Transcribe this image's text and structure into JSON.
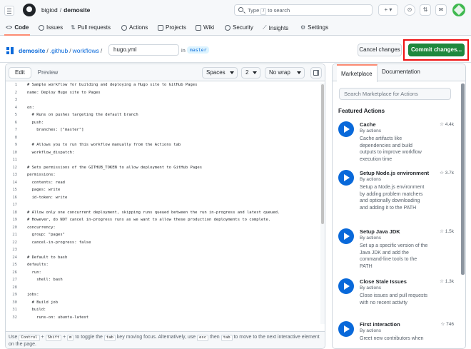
{
  "nav": {
    "owner": "bigiod",
    "repo": "demosite",
    "search_prefix": "Type",
    "search_key": "/",
    "search_suffix": "to search",
    "plus_label": "+ ▾",
    "tabs": [
      "Code",
      "Issues",
      "Pull requests",
      "Actions",
      "Projects",
      "Wiki",
      "Security",
      "Insights",
      "Settings"
    ]
  },
  "path": {
    "repo": "demosite",
    "dir1": ".github",
    "dir2": "workflows",
    "filename": "hugo.yml",
    "in_label": "in",
    "branch": "master"
  },
  "buttons": {
    "cancel": "Cancel changes",
    "commit": "Commit changes..."
  },
  "editor": {
    "tab_edit": "Edit",
    "tab_preview": "Preview",
    "indent_mode": "Spaces",
    "indent_size": "2",
    "wrap_mode": "No wrap",
    "footer": {
      "t1": "Use",
      "k1": "Control",
      "t2": "+",
      "k2": "Shift",
      "t3": "+",
      "k3": "m",
      "t4": "to toggle the",
      "k4": "tab",
      "t5": "key moving focus. Alternatively, use",
      "k5": "esc",
      "t6": "then",
      "k6": "tab",
      "t7": "to move to the next interactive element on the page."
    },
    "lines": [
      "# Sample workflow for building and deploying a Hugo site to GitHub Pages",
      "name: Deploy Hugo site to Pages",
      "",
      "on:",
      "  # Runs on pushes targeting the default branch",
      "  push:",
      "    branches: [\"master\"]",
      "",
      "  # Allows you to run this workflow manually from the Actions tab",
      "  workflow_dispatch:",
      "",
      "# Sets permissions of the GITHUB_TOKEN to allow deployment to GitHub Pages",
      "permissions:",
      "  contents: read",
      "  pages: write",
      "  id-token: write",
      "",
      "# Allow only one concurrent deployment, skipping runs queued between the run in-progress and latest queued.",
      "# However, do NOT cancel in-progress runs as we want to allow these production deployments to complete.",
      "concurrency:",
      "  group: \"pages\"",
      "  cancel-in-progress: false",
      "",
      "# Default to bash",
      "defaults:",
      "  run:",
      "    shell: bash",
      "",
      "jobs:",
      "  # Build job",
      "  build:",
      "    runs-on: ubuntu-latest"
    ]
  },
  "panel": {
    "tab_marketplace": "Marketplace",
    "tab_docs": "Documentation",
    "search_placeholder": "Search Marketplace for Actions",
    "featured": "Featured Actions",
    "actions": [
      {
        "name": "Cache",
        "by": "By actions",
        "desc": "Cache artifacts like dependencies and build outputs to improve workflow execution time",
        "stars": "☆ 4.4k"
      },
      {
        "name": "Setup Node.js environment",
        "by": "By actions",
        "desc": "Setup a Node.js environment by adding problem matchers and optionally downloading and adding it to the PATH",
        "stars": "☆ 3.7k"
      },
      {
        "name": "Setup Java JDK",
        "by": "By actions",
        "desc": "Set up a specific version of the Java JDK and add the command-line tools to the PATH",
        "stars": "☆ 1.5k"
      },
      {
        "name": "Close Stale Issues",
        "by": "By actions",
        "desc": "Close issues and pull requests with no recent activity",
        "stars": "☆ 1.3k"
      },
      {
        "name": "First interaction",
        "by": "By actions",
        "desc": "Greet new contributors when",
        "stars": "☆ 746"
      }
    ]
  },
  "colors": {
    "primary_button": "#1f883d",
    "link": "#0969da",
    "highlight_box": "#ee1111",
    "tab_underline": "#fd8c73"
  }
}
